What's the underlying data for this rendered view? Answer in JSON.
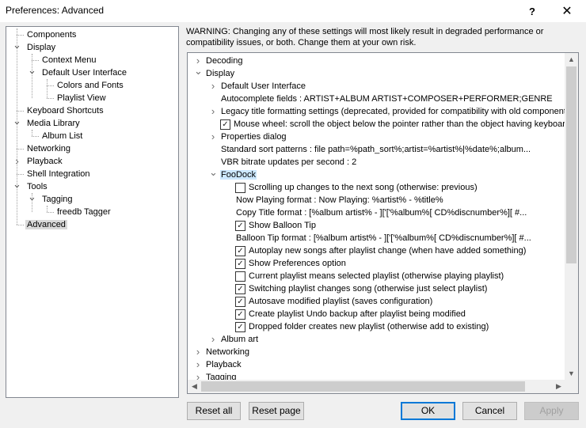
{
  "window": {
    "title": "Preferences: Advanced",
    "help_glyph": "?",
    "close_glyph": "✕"
  },
  "left_tree": [
    {
      "label": "Components",
      "level": 0,
      "expander": ""
    },
    {
      "label": "Display",
      "level": 0,
      "expander": "down"
    },
    {
      "label": "Context Menu",
      "level": 1,
      "expander": ""
    },
    {
      "label": "Default User Interface",
      "level": 1,
      "expander": "down"
    },
    {
      "label": "Colors and Fonts",
      "level": 2,
      "expander": ""
    },
    {
      "label": "Playlist View",
      "level": 2,
      "expander": ""
    },
    {
      "label": "Keyboard Shortcuts",
      "level": 0,
      "expander": ""
    },
    {
      "label": "Media Library",
      "level": 0,
      "expander": "down"
    },
    {
      "label": "Album List",
      "level": 1,
      "expander": ""
    },
    {
      "label": "Networking",
      "level": 0,
      "expander": ""
    },
    {
      "label": "Playback",
      "level": 0,
      "expander": "right"
    },
    {
      "label": "Shell Integration",
      "level": 0,
      "expander": ""
    },
    {
      "label": "Tools",
      "level": 0,
      "expander": "down"
    },
    {
      "label": "Tagging",
      "level": 1,
      "expander": "down"
    },
    {
      "label": "freedb Tagger",
      "level": 2,
      "expander": ""
    },
    {
      "label": "Advanced",
      "level": 0,
      "expander": "",
      "selected": true
    }
  ],
  "warning": "WARNING: Changing any of these settings will most likely result in degraded performance or compatibility issues, or both. Change them at your own risk.",
  "right_tree": [
    {
      "label": "Decoding",
      "level": 0,
      "expander": "right"
    },
    {
      "label": "Display",
      "level": 0,
      "expander": "down"
    },
    {
      "label": "Default User Interface",
      "level": 1,
      "expander": "right"
    },
    {
      "label": "Autocomplete fields : ARTIST+ALBUM ARTIST+COMPOSER+PERFORMER;GENRE",
      "level": 1,
      "expander": ""
    },
    {
      "label": "Legacy title formatting settings (deprecated, provided for compatibility with old component",
      "level": 1,
      "expander": "right"
    },
    {
      "label": "Mouse wheel: scroll the object below the pointer rather than the object having keyboar",
      "level": 1,
      "expander": "",
      "checkbox": true,
      "checked": true
    },
    {
      "label": "Properties dialog",
      "level": 1,
      "expander": "right"
    },
    {
      "label": "Standard sort patterns : file path=%path_sort%;artist=%artist%|%date%;album...",
      "level": 1,
      "expander": ""
    },
    {
      "label": "VBR bitrate updates per second : 2",
      "level": 1,
      "expander": ""
    },
    {
      "label": "FooDock",
      "level": 1,
      "expander": "down",
      "highlight": true
    },
    {
      "label": "Scrolling up changes to the next song (otherwise: previous)",
      "level": 2,
      "expander": "",
      "checkbox": true,
      "checked": false
    },
    {
      "label": "Now Playing format : Now Playing: %artist% - %title%",
      "level": 2,
      "expander": ""
    },
    {
      "label": "Copy Title format : [%album artist% - ]['['%album%[ CD%discnumber%][ #...",
      "level": 2,
      "expander": ""
    },
    {
      "label": "Show Balloon Tip",
      "level": 2,
      "expander": "",
      "checkbox": true,
      "checked": true
    },
    {
      "label": "Balloon Tip format : [%album artist% - ]['['%album%[ CD%discnumber%][ #...",
      "level": 2,
      "expander": ""
    },
    {
      "label": "Autoplay new songs after playlist change (when have added something)",
      "level": 2,
      "expander": "",
      "checkbox": true,
      "checked": true
    },
    {
      "label": "Show Preferences option",
      "level": 2,
      "expander": "",
      "checkbox": true,
      "checked": true
    },
    {
      "label": "Current playlist means selected playlist (otherwise playing playlist)",
      "level": 2,
      "expander": "",
      "checkbox": true,
      "checked": false
    },
    {
      "label": "Switching playlist changes song (otherwise just select playlist)",
      "level": 2,
      "expander": "",
      "checkbox": true,
      "checked": true
    },
    {
      "label": "Autosave modified playlist (saves configuration)",
      "level": 2,
      "expander": "",
      "checkbox": true,
      "checked": true
    },
    {
      "label": "Create playlist Undo backup after playlist being modified",
      "level": 2,
      "expander": "",
      "checkbox": true,
      "checked": true
    },
    {
      "label": "Dropped folder creates new playlist (otherwise add to existing)",
      "level": 2,
      "expander": "",
      "checkbox": true,
      "checked": true
    },
    {
      "label": "Album art",
      "level": 1,
      "expander": "right"
    },
    {
      "label": "Networking",
      "level": 0,
      "expander": "right"
    },
    {
      "label": "Playback",
      "level": 0,
      "expander": "right"
    },
    {
      "label": "Tagging",
      "level": 0,
      "expander": "right"
    }
  ],
  "buttons": {
    "reset_all": "Reset all",
    "reset_page": "Reset page",
    "ok": "OK",
    "cancel": "Cancel",
    "apply": "Apply"
  },
  "colors": {
    "selection_gray": "#d9d9d9",
    "highlight_blue": "#cce8ff",
    "default_button_border": "#0078d7"
  }
}
